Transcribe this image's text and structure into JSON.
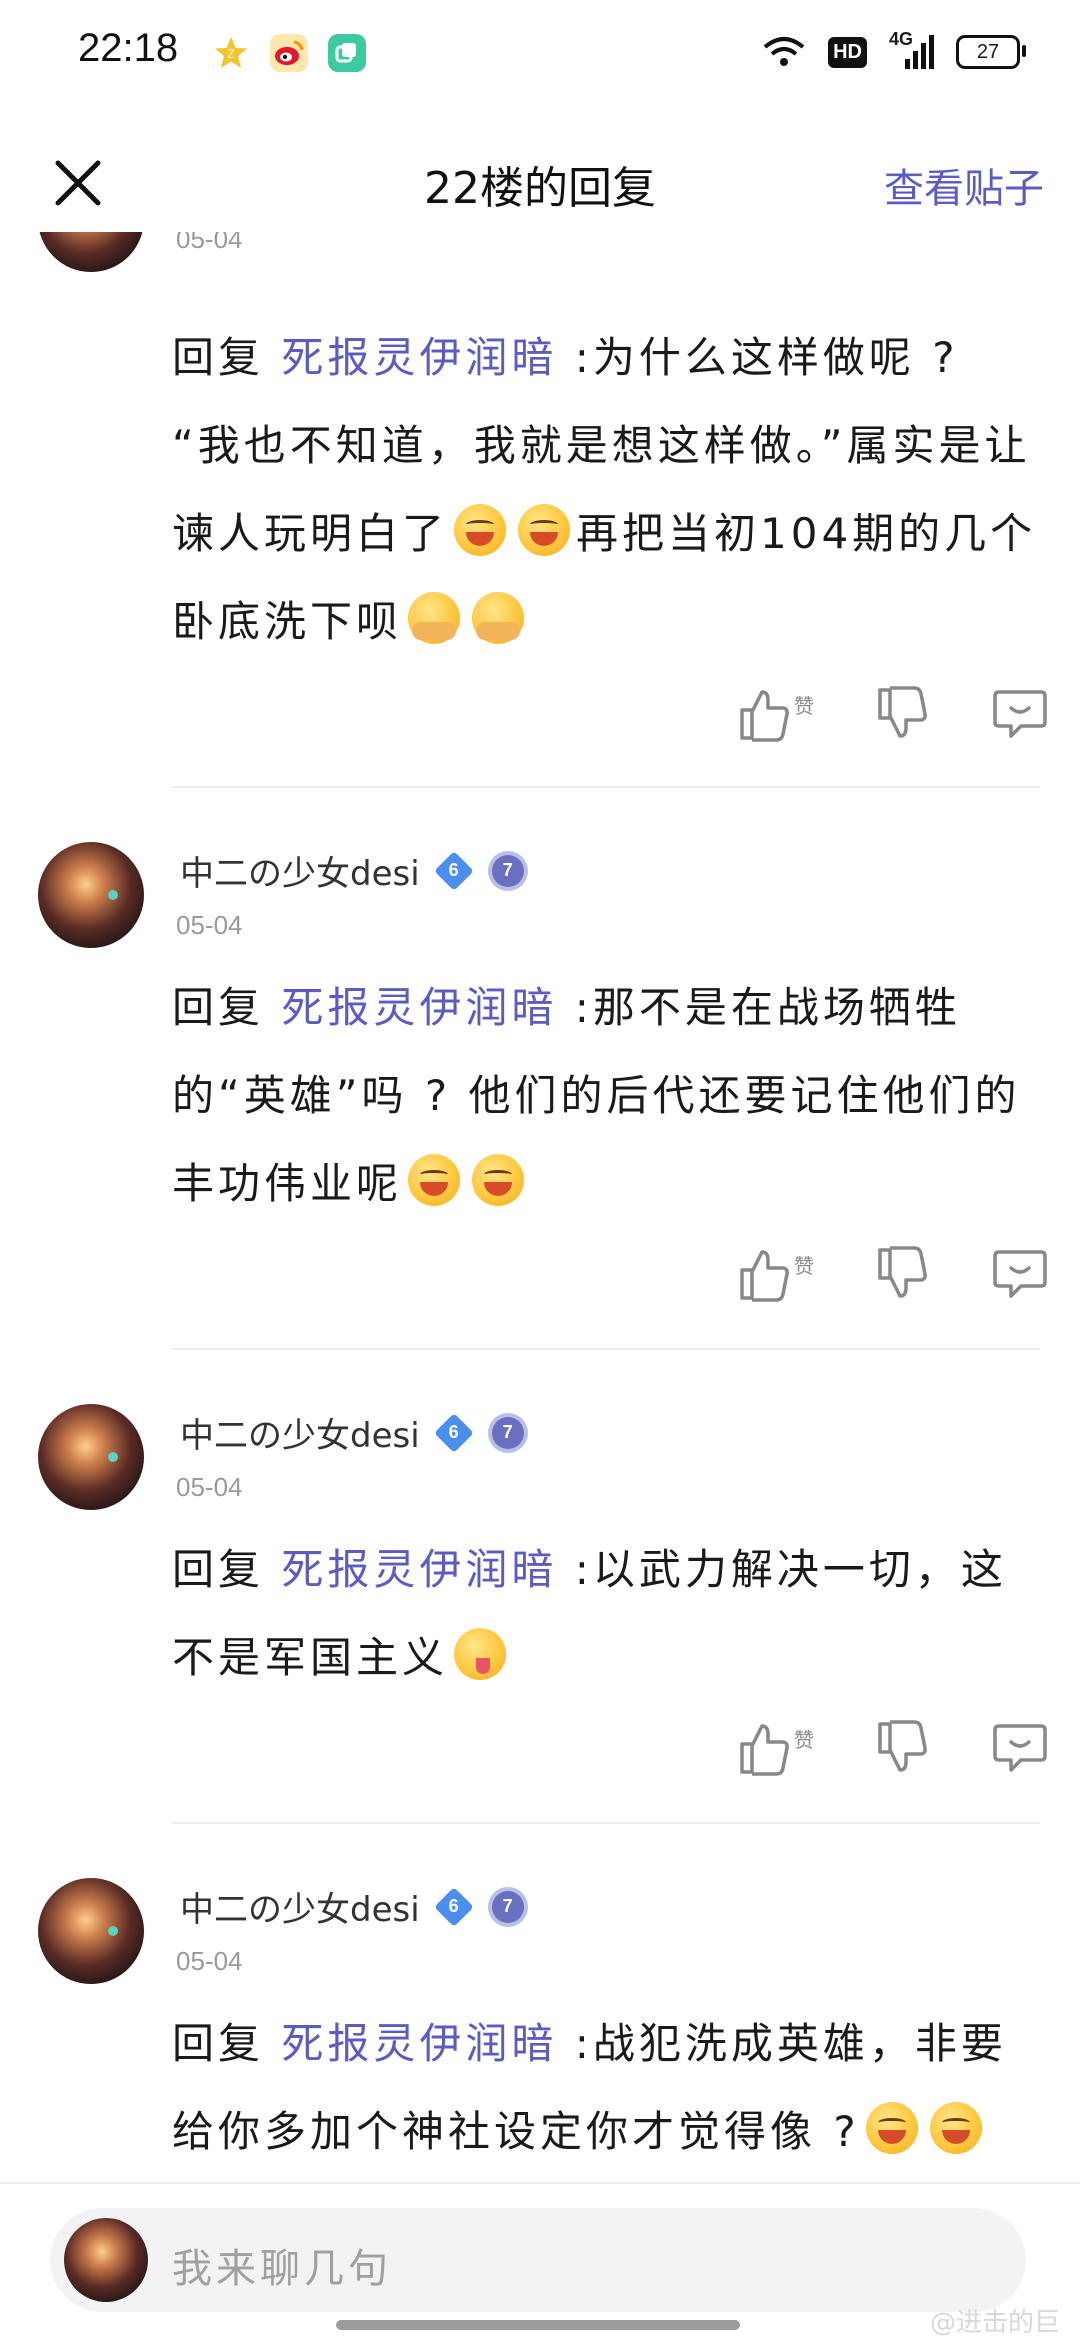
{
  "status_bar": {
    "time": "22:18",
    "hd": "HD",
    "network": "4G",
    "battery": "27",
    "icons": [
      "star-badge-icon",
      "weibo-icon",
      "app-square-icon",
      "wifi-icon",
      "signal-icon"
    ]
  },
  "header": {
    "title": "22楼的回复",
    "view_post": "查看贴子"
  },
  "top_partial": {
    "date": "05-04",
    "text_prefix": "回复 ",
    "mention": "死报灵伊润暗",
    "text": " :为什么这样做呢 ? “我也不知道，我就是想这样做。”属实是让谏人玩明白了",
    "text_2": "再把当初104期的几个卧底洗下呗"
  },
  "replies": [
    {
      "name": "中二の少女desi",
      "level": "6",
      "badge": "7",
      "date": "05-04",
      "prefix": "回复 ",
      "mention": "死报灵伊润暗",
      "text": " :那不是在战场牺牲的“英雄”吗 ? 他们的后代还要记住他们的丰功伟业呢"
    },
    {
      "name": "中二の少女desi",
      "level": "6",
      "badge": "7",
      "date": "05-04",
      "prefix": "回复 ",
      "mention": "死报灵伊润暗",
      "text": " :以武力解决一切，这不是军国主义"
    },
    {
      "name": "中二の少女desi",
      "level": "6",
      "badge": "7",
      "date": "05-04",
      "prefix": "回复 ",
      "mention": "死报灵伊润暗",
      "text": " :战犯洗成英雄，非要给你多加个神社设定你才觉得像 ?"
    }
  ],
  "actions": {
    "like_label": "赞"
  },
  "input": {
    "placeholder": "我来聊几句"
  },
  "watermark": "@进击的巨",
  "colors": {
    "accent": "#5b5cc3",
    "level_diamond": "#4a8ff0"
  }
}
